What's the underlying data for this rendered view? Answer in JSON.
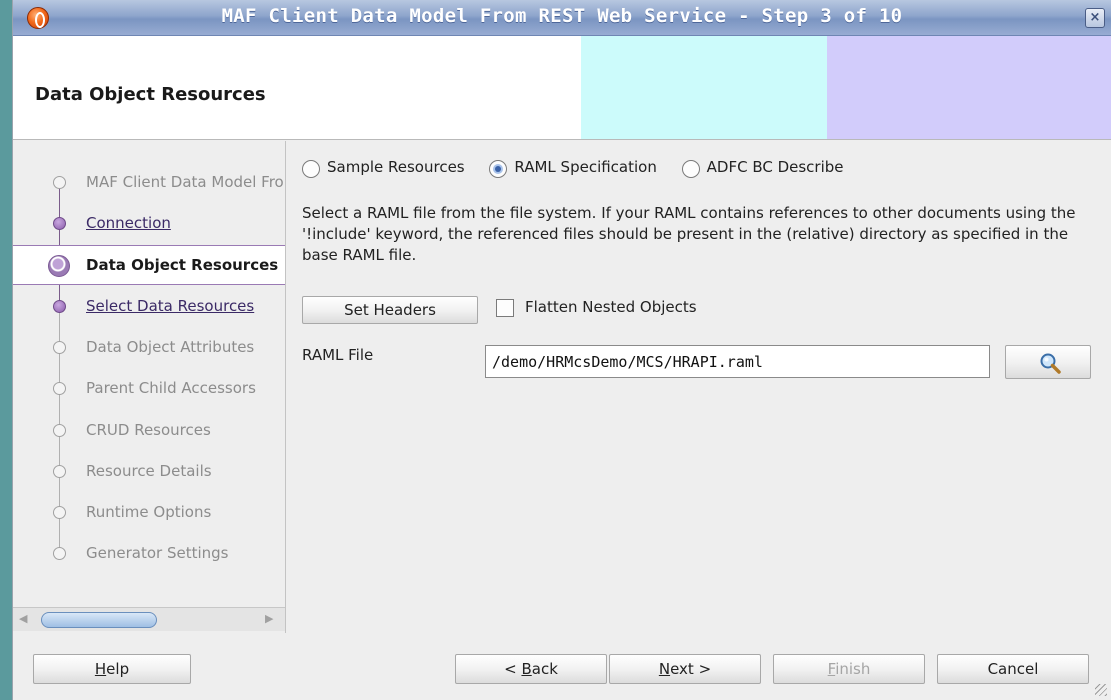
{
  "window": {
    "title": "MAF Client Data Model From REST Web Service - Step 3 of 10",
    "close_glyph": "×"
  },
  "header": {
    "title": "Data Object Resources",
    "colors": {
      "cyan": "#ccfbfb",
      "lavender": "#d2ccfb"
    }
  },
  "nav": {
    "items": [
      {
        "label": "MAF Client Data Model From REST Web Service",
        "state": "pending"
      },
      {
        "label": "Connection",
        "state": "visited"
      },
      {
        "label": "Data Object Resources",
        "state": "current"
      },
      {
        "label": "Select Data Resources",
        "state": "visited"
      },
      {
        "label": "Data Object Attributes",
        "state": "pending"
      },
      {
        "label": "Parent Child Accessors",
        "state": "pending"
      },
      {
        "label": "CRUD Resources",
        "state": "pending"
      },
      {
        "label": "Resource Details",
        "state": "pending"
      },
      {
        "label": "Runtime Options",
        "state": "pending"
      },
      {
        "label": "Generator Settings",
        "state": "pending"
      }
    ],
    "scroll_left_glyph": "◀",
    "scroll_right_glyph": "▶"
  },
  "source_options": [
    {
      "label": "Sample Resources",
      "checked": false
    },
    {
      "label": "RAML Specification",
      "checked": true
    },
    {
      "label": "ADFC BC Describe",
      "checked": false
    }
  ],
  "description": "Select a RAML file from the file system. If your RAML contains references to other documents using the '!include' keyword, the referenced files should be present in the (relative) directory as specified in the base RAML file.",
  "set_headers_label": "Set Headers",
  "flatten_label": "Flatten Nested Objects",
  "flatten_checked": false,
  "raml_file": {
    "label": "RAML File",
    "value": "/demo/HRMcsDemo/MCS/HRAPI.raml",
    "browse_icon": "magnifier-icon"
  },
  "footer": {
    "help": {
      "mnemonic": "H",
      "rest": "elp"
    },
    "back": {
      "pre": "< ",
      "mnemonic": "B",
      "rest": "ack"
    },
    "next": {
      "mnemonic": "N",
      "rest": "ext >"
    },
    "finish": {
      "mnemonic": "F",
      "rest": "inish",
      "enabled": false
    },
    "cancel": {
      "label": "Cancel"
    }
  }
}
